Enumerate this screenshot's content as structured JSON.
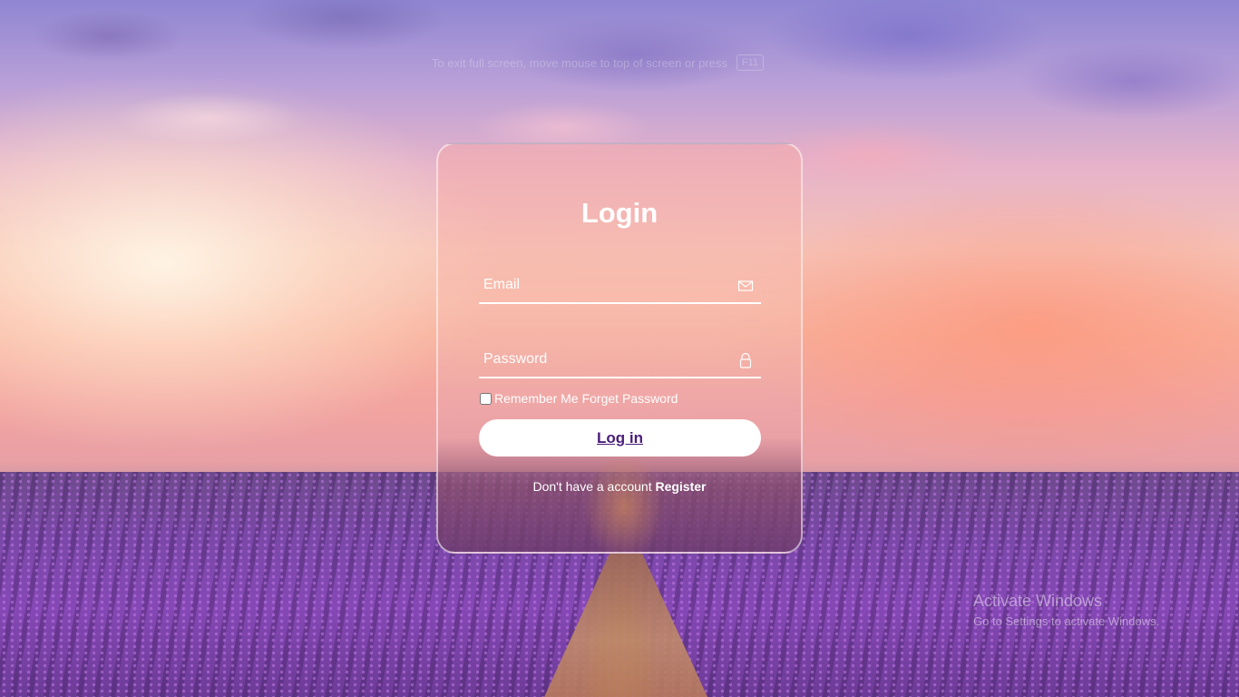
{
  "fullscreen_hint": {
    "text": "To exit full screen, move mouse to top of screen or press",
    "key": "F11"
  },
  "login_card": {
    "title": "Login",
    "email_placeholder": "Email",
    "email_icon": "envelope-icon",
    "password_placeholder": "Password",
    "password_icon": "lock-icon",
    "remember_label": "Remember Me",
    "forget_label": "Forget Password",
    "login_button": "Log in",
    "no_account_text": "Don't have a account",
    "register_link": "Register"
  },
  "watermark": {
    "line1": "Activate Windows",
    "line2": "Go to Settings to activate Windows."
  },
  "colors": {
    "button_text": "#4a1d7a",
    "card_border": "#ffffff"
  }
}
